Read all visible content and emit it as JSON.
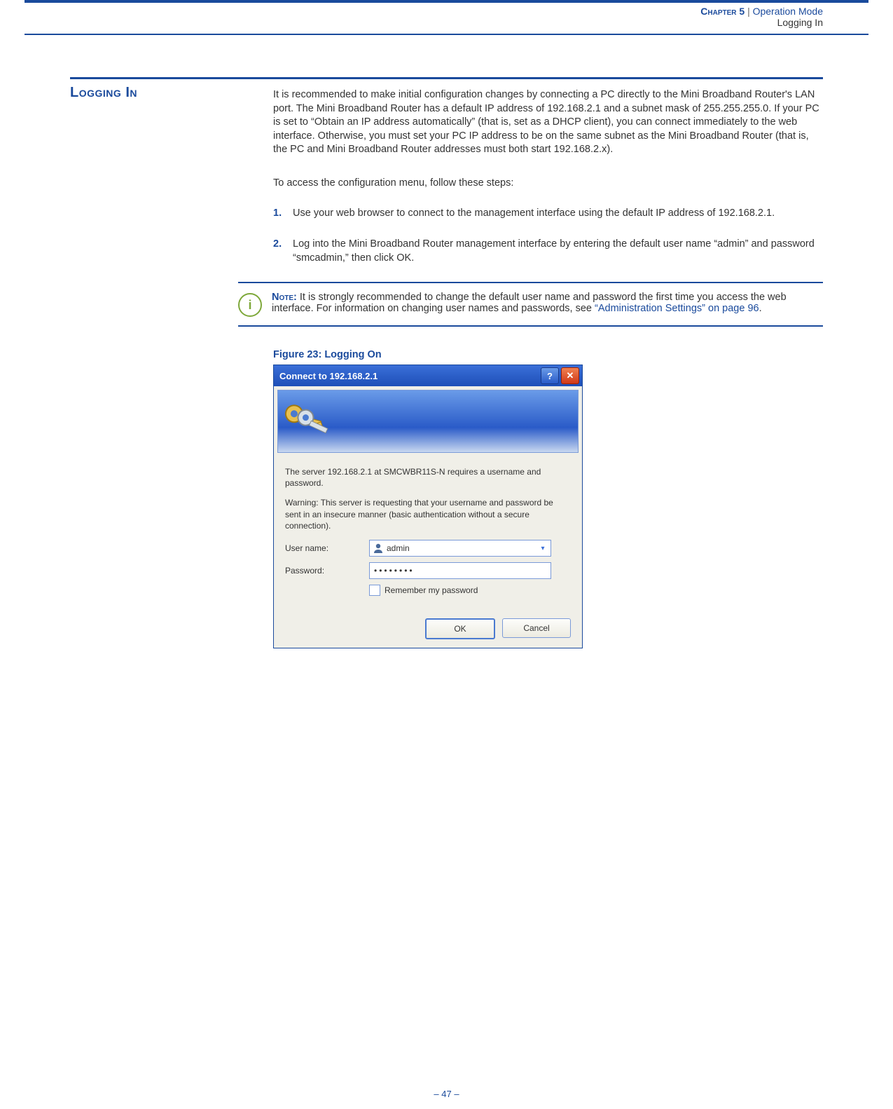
{
  "header": {
    "chapter": "Chapter 5",
    "separator": "|",
    "title": "Operation Mode",
    "subtitle": "Logging In"
  },
  "section": {
    "heading": "Logging In",
    "para1": "It is recommended to make initial configuration changes by connecting a PC directly to the Mini Broadband Router's LAN port. The Mini Broadband Router has a default IP address of 192.168.2.1 and a subnet mask of 255.255.255.0. If your PC is set to “Obtain an IP address automatically” (that is, set as a DHCP client), you can connect immediately to the web interface. Otherwise, you must set your PC IP address to be on the same subnet as the Mini Broadband Router (that is, the PC and Mini Broadband Router addresses must both start 192.168.2.x).",
    "para2": "To access the configuration menu, follow these steps:",
    "steps": [
      {
        "num": "1.",
        "text": "Use your web browser to connect to the management interface using the default IP address of 192.168.2.1."
      },
      {
        "num": "2.",
        "text": "Log into the Mini Broadband Router management interface by entering the default user name “admin” and password “smcadmin,” then click OK."
      }
    ]
  },
  "note": {
    "label": "Note:",
    "text_before_link": " It is strongly recommended to change the default user name and password the first time you access the web interface. For information on changing user names and passwords, see ",
    "link_text": "“Administration Settings” on page 96",
    "text_after_link": "."
  },
  "figure": {
    "caption": "Figure 23:  Logging On"
  },
  "dialog": {
    "title": "Connect to 192.168.2.1",
    "help_symbol": "?",
    "close_symbol": "✕",
    "msg1": "The server 192.168.2.1 at SMCWBR11S-N requires a username and password.",
    "msg2": "Warning: This server is requesting that your username and password be sent in an insecure manner (basic authentication without a secure connection).",
    "username_label": "User name:",
    "username_value": "admin",
    "password_label": "Password:",
    "password_value": "••••••••",
    "remember_label": "Remember my password",
    "ok_label": "OK",
    "cancel_label": "Cancel"
  },
  "footer": {
    "page": "–  47  –"
  }
}
